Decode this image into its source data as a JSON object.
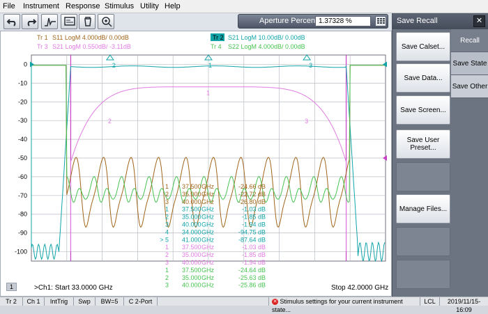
{
  "menu": [
    "File",
    "Instrument",
    "Response",
    "Stimulus",
    "Utility",
    "Help"
  ],
  "toolbar": {
    "icons": [
      "undo-icon",
      "redo-icon",
      "marker-search-icon",
      "memory-icon",
      "trash-icon",
      "zoom-icon"
    ]
  },
  "aperture": {
    "label": "Aperture Percent",
    "value": "1.37328 %"
  },
  "traces": {
    "tr1": {
      "tag": "Tr 1",
      "text": "S11 LogM 4.000dB/ 0.00dB",
      "color": "#a0651a"
    },
    "tr2": {
      "tag": "Tr 2",
      "text": "S21 LogM 10.00dB/ 0.00dB",
      "color": "#10a4a8"
    },
    "tr3": {
      "tag": "Tr 3",
      "text": "S21 LogM 0.550dB/ -3.11dB",
      "color": "#e07be0"
    },
    "tr4": {
      "tag": "Tr 4",
      "text": "S22 LogM 4.000dB/ 0.00dB",
      "color": "#46c250"
    }
  },
  "chart_data": {
    "type": "line",
    "title": "",
    "xlabel": "",
    "ylabel": "",
    "x_range_ghz": [
      33.0,
      42.0
    ],
    "ylim": [
      -105,
      5
    ],
    "y_ticks": [
      "0",
      "-10",
      "-20",
      "-30",
      "-40",
      "-50",
      "-60",
      "-70",
      "-80",
      "-90",
      "-100"
    ],
    "x_gridlines": 10,
    "markers_top": [
      "2",
      "1",
      "3"
    ],
    "markers_tr3": [
      "2",
      "1",
      "3"
    ],
    "marker_table": [
      {
        "n": "1",
        "f": "37.500",
        "u": "GHz",
        "v": "-24.66 dB",
        "c": "#a0651a"
      },
      {
        "n": "2",
        "f": "35.000",
        "u": "GHz",
        "v": "-22.72 dB",
        "c": "#a0651a"
      },
      {
        "n": "3",
        "f": "40.000",
        "u": "GHz",
        "v": "-26.80 dB",
        "c": "#a0651a"
      },
      {
        "n": "1",
        "f": "37.500",
        "u": "GHz",
        "v": "-1.03 dB",
        "c": "#10a4a8"
      },
      {
        "n": "2",
        "f": "35.000",
        "u": "GHz",
        "v": "-1.85 dB",
        "c": "#10a4a8"
      },
      {
        "n": "3",
        "f": "40.000",
        "u": "GHz",
        "v": "-1.94 dB",
        "c": "#10a4a8"
      },
      {
        "n": "4",
        "f": "34.000",
        "u": "GHz",
        "v": "-94.75 dB",
        "c": "#10a4a8"
      },
      {
        "n": "> 5",
        "f": "41.000",
        "u": "GHz",
        "v": "-87.64 dB",
        "c": "#10a4a8"
      },
      {
        "n": "1",
        "f": "37.500",
        "u": "GHz",
        "v": "-1.03 dB",
        "c": "#e07be0"
      },
      {
        "n": "2",
        "f": "35.000",
        "u": "GHz",
        "v": "-1.85 dB",
        "c": "#e07be0"
      },
      {
        "n": "3",
        "f": "40.000",
        "u": "GHz",
        "v": "-1.94 dB",
        "c": "#e07be0"
      },
      {
        "n": "1",
        "f": "37.500",
        "u": "GHz",
        "v": "-24.64 dB",
        "c": "#46c250"
      },
      {
        "n": "2",
        "f": "35.000",
        "u": "GHz",
        "v": "-25.63 dB",
        "c": "#46c250"
      },
      {
        "n": "3",
        "f": "40.000",
        "u": "GHz",
        "v": "-25.86 dB",
        "c": "#46c250"
      }
    ]
  },
  "footer": {
    "channel_num": "1",
    "start": ">Ch1: Start  33.0000 GHz",
    "stop": "Stop  42.0000 GHz"
  },
  "statusbar": {
    "items": [
      "Tr 2",
      "Ch 1",
      "IntTrig",
      "Swp",
      "BW=5",
      "C  2-Port"
    ],
    "message": "Stimulus settings for your current instrument state...",
    "lcl": "LCL",
    "datetime": "2019/11/15-16:09"
  },
  "panel": {
    "title": "Save Recall",
    "close": "✕",
    "buttons": [
      "Save Calset...",
      "Save Data...",
      "Save Screen...",
      "Save User Preset...",
      "Manage Files..."
    ],
    "tabs": [
      "Recall",
      "Save State",
      "Save Other"
    ]
  }
}
